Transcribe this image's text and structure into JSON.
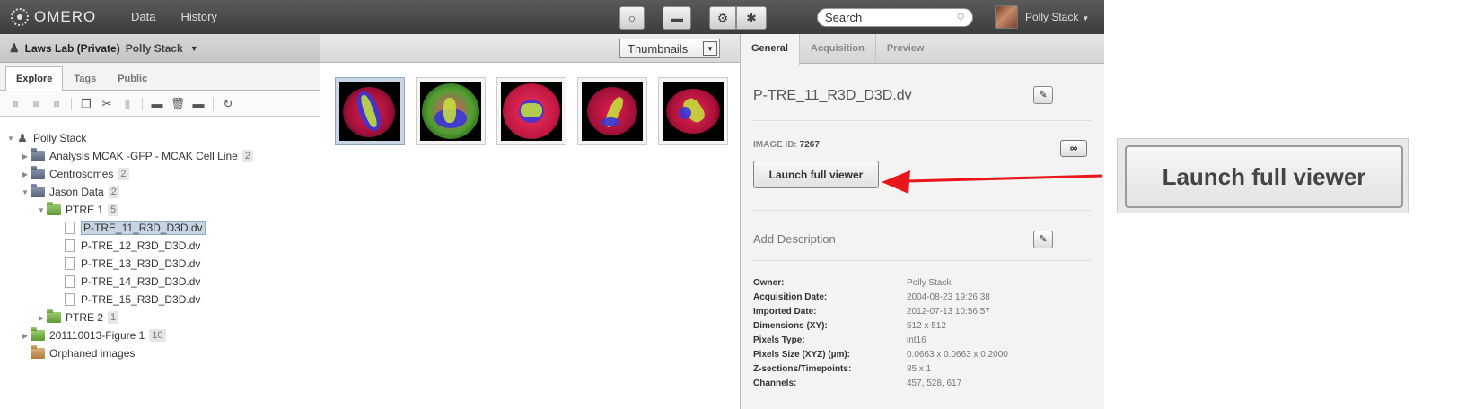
{
  "topbar": {
    "logo": "OMERO",
    "nav": [
      "Data",
      "History"
    ],
    "search_placeholder": "Search",
    "user": "Polly Stack"
  },
  "group_bar": {
    "group": "Laws Lab (Private)",
    "user": "Polly Stack"
  },
  "left_tabs": [
    "Explore",
    "Tags",
    "Public"
  ],
  "tree": {
    "root": "Polly Stack",
    "projects": [
      {
        "name": "Analysis MCAK -GFP - MCAK Cell Line",
        "count": "2"
      },
      {
        "name": "Centrosomes",
        "count": "2"
      },
      {
        "name": "Jason Data",
        "count": "2"
      }
    ],
    "dataset_open": {
      "name": "PTRE 1",
      "count": "5"
    },
    "images": [
      "P-TRE_11_R3D_D3D.dv",
      "P-TRE_12_R3D_D3D.dv",
      "P-TRE_13_R3D_D3D.dv",
      "P-TRE_14_R3D_D3D.dv",
      "P-TRE_15_R3D_D3D.dv"
    ],
    "dataset_closed": {
      "name": "PTRE 2",
      "count": "1"
    },
    "project_last": {
      "name": "201110013-Figure 1",
      "count": "10"
    },
    "orphaned": "Orphaned images"
  },
  "center": {
    "view_mode": "Thumbnails"
  },
  "right_tabs": [
    "General",
    "Acquisition",
    "Preview"
  ],
  "details": {
    "image_name": "P-TRE_11_R3D_D3D.dv",
    "image_id_label": "IMAGE ID:",
    "image_id": "7267",
    "launch_label": "Launch full viewer",
    "add_description": "Add Description",
    "metadata": [
      {
        "k": "Owner:",
        "v": "Polly Stack"
      },
      {
        "k": "Acquisition Date:",
        "v": "2004-08-23 19:26:38"
      },
      {
        "k": "Imported Date:",
        "v": "2012-07-13 10:56:57"
      },
      {
        "k": "Dimensions (XY):",
        "v": "512 x 512"
      },
      {
        "k": "Pixels Type:",
        "v": "int16"
      },
      {
        "k": "Pixels Size (XYZ) (µm):",
        "v": "0.0663 x 0.0663 x 0.2000"
      },
      {
        "k": "Z-sections/Timepoints:",
        "v": "85 x 1"
      },
      {
        "k": "Channels:",
        "v": "457, 528, 617"
      }
    ]
  },
  "callout": {
    "label": "Launch full viewer"
  },
  "colors": {
    "arrow": "#e8171c",
    "selection": "#c7d4e3"
  },
  "icons": [
    "lightbulb-icon",
    "basket-icon",
    "settings-icon",
    "star-icon",
    "search-icon",
    "person-icon",
    "pencil-icon",
    "link-icon"
  ]
}
